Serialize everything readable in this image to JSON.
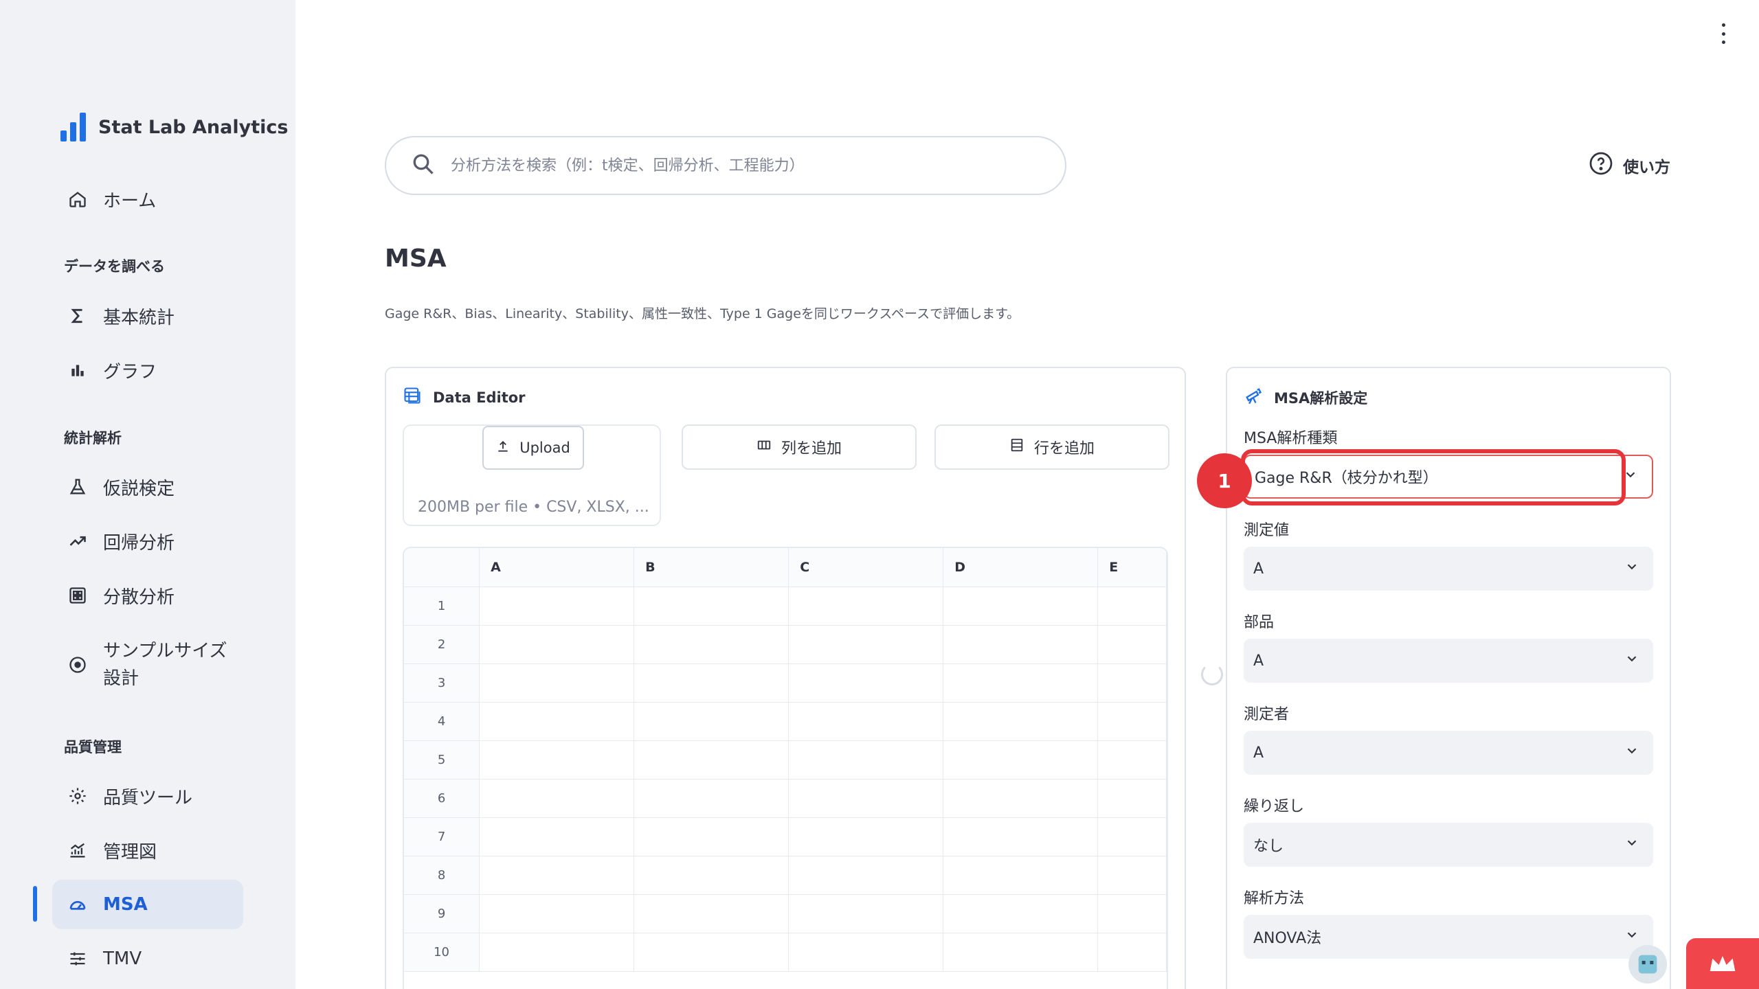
{
  "brand": {
    "name": "Stat Lab Analytics"
  },
  "sidebar": {
    "home": "ホーム",
    "section_explore": "データを調べる",
    "basic_stats": "基本統計",
    "graph": "グラフ",
    "section_stats": "統計解析",
    "hypothesis": "仮説検定",
    "regression": "回帰分析",
    "anova": "分散分析",
    "sample_size_line1": "サンプルサイズ",
    "sample_size_line2": "設計",
    "section_quality": "品質管理",
    "quality_tools": "品質ツール",
    "control_chart": "管理図",
    "msa": "MSA",
    "tmv": "TMV"
  },
  "search": {
    "placeholder": "分析方法を検索（例：t検定、回帰分析、工程能力）"
  },
  "help": {
    "label": "使い方"
  },
  "page": {
    "title": "MSA",
    "description": "Gage R&R、Bias、Linearity、Stability、属性一致性、Type 1 Gageを同じワークスペースで評価します。"
  },
  "editor": {
    "title": "Data Editor",
    "upload_label": "Upload",
    "upload_hint": "200MB per file • CSV, XLSX, ...",
    "add_column": "列を追加",
    "add_row": "行を追加",
    "columns": [
      "A",
      "B",
      "C",
      "D",
      "E"
    ],
    "rows": [
      "1",
      "2",
      "3",
      "4",
      "5",
      "6",
      "7",
      "8",
      "9",
      "10"
    ]
  },
  "settings": {
    "title": "MSA解析設定",
    "analysis_type_label": "MSA解析種類",
    "analysis_type_value": "Gage R&R（枝分かれ型）",
    "measurement_label": "測定値",
    "measurement_value": "A",
    "part_label": "部品",
    "part_value": "A",
    "operator_label": "測定者",
    "operator_value": "A",
    "repeat_label": "繰り返し",
    "repeat_value": "なし",
    "method_label": "解析方法",
    "method_value": "ANOVA法"
  },
  "annotation": {
    "badge": "1"
  },
  "colors": {
    "accent": "#1f6fe5",
    "highlight": "#e5343a"
  }
}
